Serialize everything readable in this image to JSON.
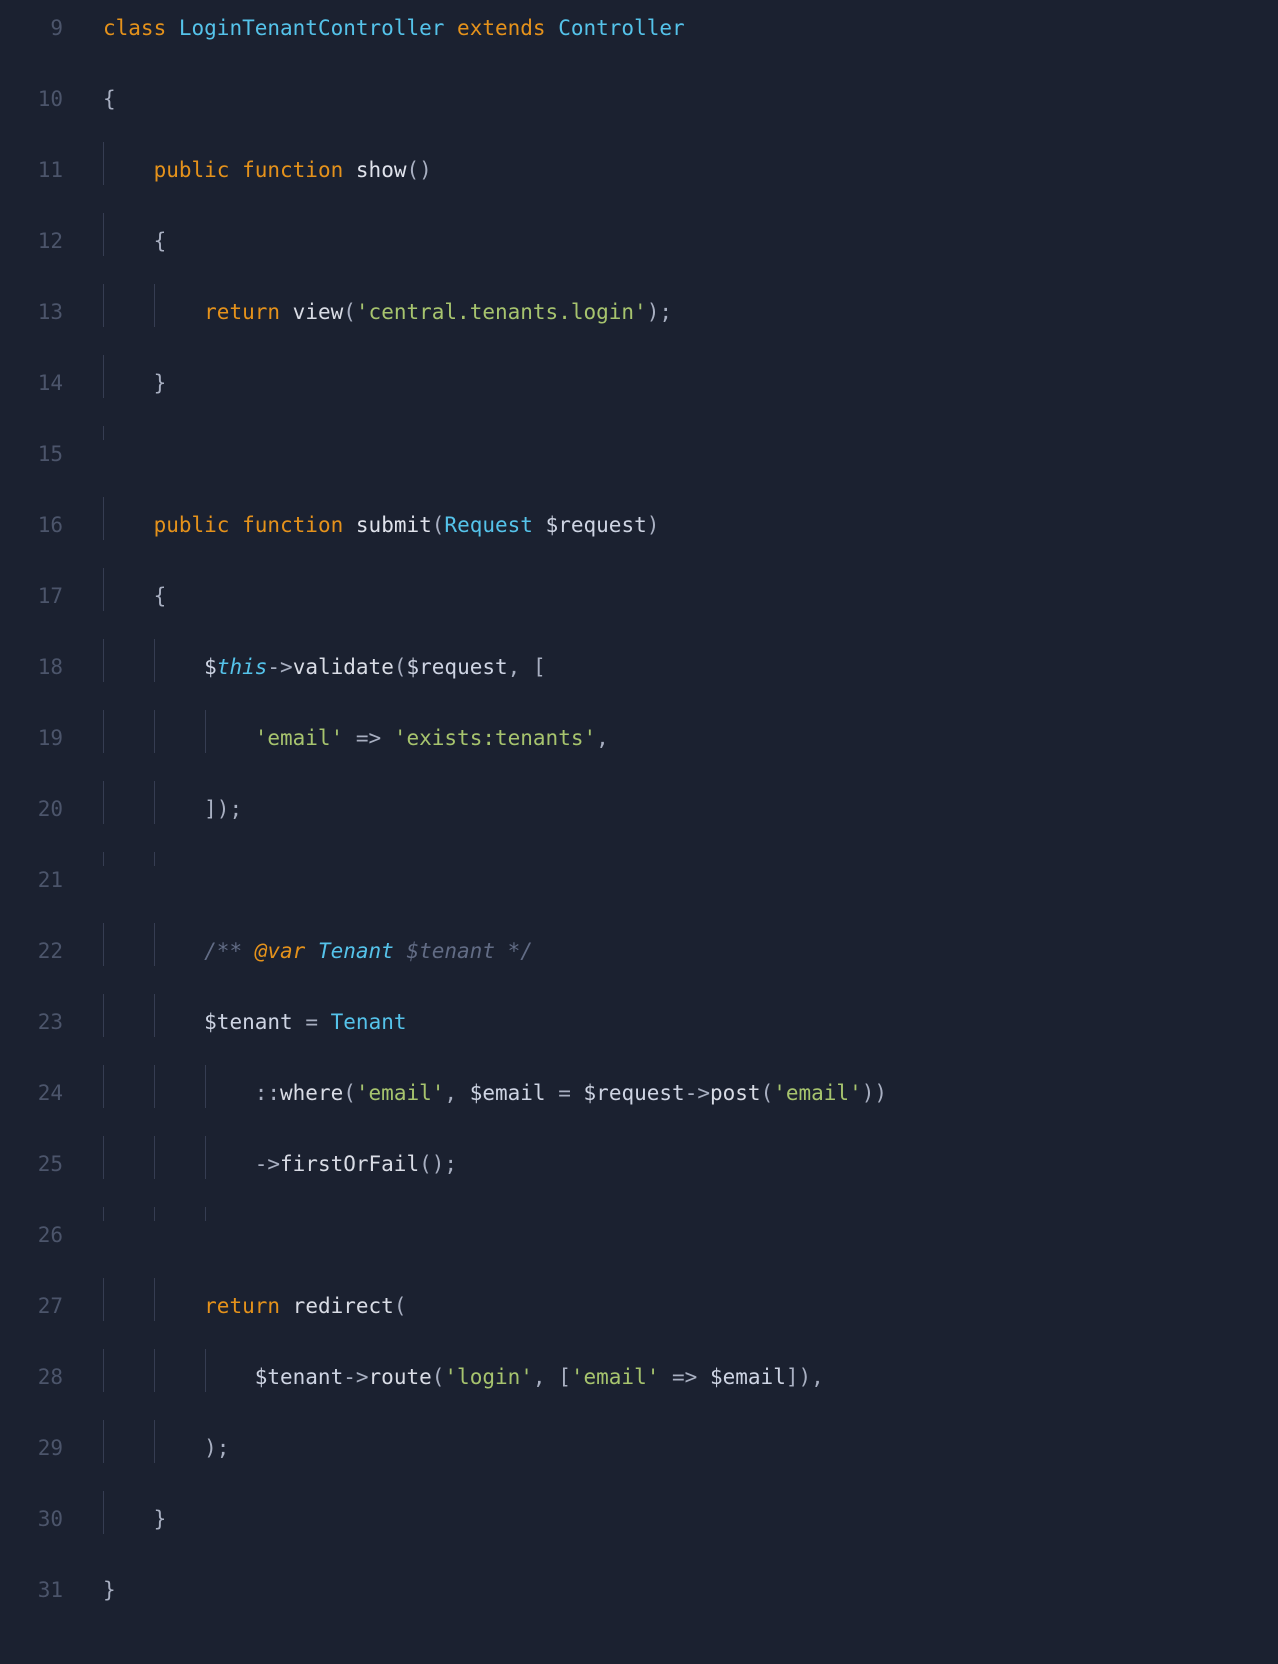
{
  "editor": {
    "lines": [
      {
        "num": "9",
        "tokens": [
          {
            "cls": "kw-class",
            "t": "class"
          },
          {
            "cls": "plain",
            "t": " "
          },
          {
            "cls": "cls-name",
            "t": "LoginTenantController"
          },
          {
            "cls": "plain",
            "t": " "
          },
          {
            "cls": "kw-class",
            "t": "extends"
          },
          {
            "cls": "plain",
            "t": " "
          },
          {
            "cls": "cls-name",
            "t": "Controller"
          }
        ],
        "guides": []
      },
      {
        "num": "10",
        "tokens": [
          {
            "cls": "punc",
            "t": "{"
          }
        ],
        "guides": []
      },
      {
        "num": "11",
        "tokens": [
          {
            "cls": "plain",
            "t": "    "
          },
          {
            "cls": "kw-pub",
            "t": "public"
          },
          {
            "cls": "plain",
            "t": " "
          },
          {
            "cls": "kw-func",
            "t": "function"
          },
          {
            "cls": "plain",
            "t": " "
          },
          {
            "cls": "fn-def",
            "t": "show"
          },
          {
            "cls": "punc",
            "t": "()"
          }
        ],
        "guides": [
          0
        ]
      },
      {
        "num": "12",
        "tokens": [
          {
            "cls": "plain",
            "t": "    "
          },
          {
            "cls": "punc",
            "t": "{"
          }
        ],
        "guides": [
          0
        ]
      },
      {
        "num": "13",
        "tokens": [
          {
            "cls": "plain",
            "t": "        "
          },
          {
            "cls": "kw-return",
            "t": "return"
          },
          {
            "cls": "plain",
            "t": " "
          },
          {
            "cls": "fn-call",
            "t": "view"
          },
          {
            "cls": "punc",
            "t": "("
          },
          {
            "cls": "str",
            "t": "'central.tenants.login'"
          },
          {
            "cls": "punc",
            "t": ");"
          }
        ],
        "guides": [
          0,
          1
        ]
      },
      {
        "num": "14",
        "tokens": [
          {
            "cls": "plain",
            "t": "    "
          },
          {
            "cls": "punc",
            "t": "}"
          }
        ],
        "guides": [
          0
        ]
      },
      {
        "num": "15",
        "tokens": [],
        "guides": [
          0
        ]
      },
      {
        "num": "16",
        "tokens": [
          {
            "cls": "plain",
            "t": "    "
          },
          {
            "cls": "kw-pub",
            "t": "public"
          },
          {
            "cls": "plain",
            "t": " "
          },
          {
            "cls": "kw-func",
            "t": "function"
          },
          {
            "cls": "plain",
            "t": " "
          },
          {
            "cls": "fn-def",
            "t": "submit"
          },
          {
            "cls": "punc",
            "t": "("
          },
          {
            "cls": "cls-name",
            "t": "Request"
          },
          {
            "cls": "plain",
            "t": " "
          },
          {
            "cls": "var",
            "t": "$request"
          },
          {
            "cls": "punc",
            "t": ")"
          }
        ],
        "guides": [
          0
        ]
      },
      {
        "num": "17",
        "tokens": [
          {
            "cls": "plain",
            "t": "    "
          },
          {
            "cls": "punc",
            "t": "{"
          }
        ],
        "guides": [
          0
        ]
      },
      {
        "num": "18",
        "tokens": [
          {
            "cls": "plain",
            "t": "        "
          },
          {
            "cls": "var",
            "t": "$"
          },
          {
            "cls": "this",
            "t": "this"
          },
          {
            "cls": "op",
            "t": "->"
          },
          {
            "cls": "fn-call",
            "t": "validate"
          },
          {
            "cls": "punc",
            "t": "("
          },
          {
            "cls": "var",
            "t": "$request"
          },
          {
            "cls": "punc",
            "t": ", ["
          }
        ],
        "guides": [
          0,
          1
        ]
      },
      {
        "num": "19",
        "tokens": [
          {
            "cls": "plain",
            "t": "            "
          },
          {
            "cls": "str",
            "t": "'email'"
          },
          {
            "cls": "plain",
            "t": " "
          },
          {
            "cls": "op",
            "t": "=>"
          },
          {
            "cls": "plain",
            "t": " "
          },
          {
            "cls": "str",
            "t": "'exists:tenants'"
          },
          {
            "cls": "punc",
            "t": ","
          }
        ],
        "guides": [
          0,
          1,
          2
        ]
      },
      {
        "num": "20",
        "tokens": [
          {
            "cls": "plain",
            "t": "        "
          },
          {
            "cls": "punc",
            "t": "]);"
          }
        ],
        "guides": [
          0,
          1
        ]
      },
      {
        "num": "21",
        "tokens": [],
        "guides": [
          0,
          1
        ]
      },
      {
        "num": "22",
        "tokens": [
          {
            "cls": "plain",
            "t": "        "
          },
          {
            "cls": "cmt",
            "t": "/** "
          },
          {
            "cls": "cmt-tag",
            "t": "@var"
          },
          {
            "cls": "cmt",
            "t": " "
          },
          {
            "cls": "cmt-type",
            "t": "Tenant"
          },
          {
            "cls": "cmt",
            "t": " $tenant */"
          }
        ],
        "guides": [
          0,
          1
        ]
      },
      {
        "num": "23",
        "tokens": [
          {
            "cls": "plain",
            "t": "        "
          },
          {
            "cls": "var",
            "t": "$tenant"
          },
          {
            "cls": "plain",
            "t": " "
          },
          {
            "cls": "op",
            "t": "="
          },
          {
            "cls": "plain",
            "t": " "
          },
          {
            "cls": "cls-name",
            "t": "Tenant"
          }
        ],
        "guides": [
          0,
          1
        ]
      },
      {
        "num": "24",
        "tokens": [
          {
            "cls": "plain",
            "t": "            "
          },
          {
            "cls": "op",
            "t": "::"
          },
          {
            "cls": "fn-call",
            "t": "where"
          },
          {
            "cls": "punc",
            "t": "("
          },
          {
            "cls": "str",
            "t": "'email'"
          },
          {
            "cls": "punc",
            "t": ", "
          },
          {
            "cls": "var",
            "t": "$email"
          },
          {
            "cls": "plain",
            "t": " "
          },
          {
            "cls": "op",
            "t": "="
          },
          {
            "cls": "plain",
            "t": " "
          },
          {
            "cls": "var",
            "t": "$request"
          },
          {
            "cls": "op",
            "t": "->"
          },
          {
            "cls": "fn-call",
            "t": "post"
          },
          {
            "cls": "punc",
            "t": "("
          },
          {
            "cls": "str",
            "t": "'email'"
          },
          {
            "cls": "punc",
            "t": "))"
          }
        ],
        "guides": [
          0,
          1,
          2
        ]
      },
      {
        "num": "25",
        "tokens": [
          {
            "cls": "plain",
            "t": "            "
          },
          {
            "cls": "op",
            "t": "->"
          },
          {
            "cls": "fn-call",
            "t": "firstOrFail"
          },
          {
            "cls": "punc",
            "t": "();"
          }
        ],
        "guides": [
          0,
          1,
          2
        ]
      },
      {
        "num": "26",
        "tokens": [],
        "guides": [
          0,
          1,
          2
        ]
      },
      {
        "num": "27",
        "tokens": [
          {
            "cls": "plain",
            "t": "        "
          },
          {
            "cls": "kw-return",
            "t": "return"
          },
          {
            "cls": "plain",
            "t": " "
          },
          {
            "cls": "fn-call",
            "t": "redirect"
          },
          {
            "cls": "punc",
            "t": "("
          }
        ],
        "guides": [
          0,
          1
        ]
      },
      {
        "num": "28",
        "tokens": [
          {
            "cls": "plain",
            "t": "            "
          },
          {
            "cls": "var",
            "t": "$tenant"
          },
          {
            "cls": "op",
            "t": "->"
          },
          {
            "cls": "fn-call",
            "t": "route"
          },
          {
            "cls": "punc",
            "t": "("
          },
          {
            "cls": "str",
            "t": "'login'"
          },
          {
            "cls": "punc",
            "t": ", ["
          },
          {
            "cls": "str",
            "t": "'email'"
          },
          {
            "cls": "plain",
            "t": " "
          },
          {
            "cls": "op",
            "t": "=>"
          },
          {
            "cls": "plain",
            "t": " "
          },
          {
            "cls": "var",
            "t": "$email"
          },
          {
            "cls": "punc",
            "t": "]),"
          }
        ],
        "guides": [
          0,
          1,
          2
        ]
      },
      {
        "num": "29",
        "tokens": [
          {
            "cls": "plain",
            "t": "        "
          },
          {
            "cls": "punc",
            "t": ");"
          }
        ],
        "guides": [
          0,
          1
        ]
      },
      {
        "num": "30",
        "tokens": [
          {
            "cls": "plain",
            "t": "    "
          },
          {
            "cls": "punc",
            "t": "}"
          }
        ],
        "guides": [
          0
        ]
      },
      {
        "num": "31",
        "tokens": [
          {
            "cls": "punc",
            "t": "}"
          }
        ],
        "guides": []
      }
    ]
  }
}
